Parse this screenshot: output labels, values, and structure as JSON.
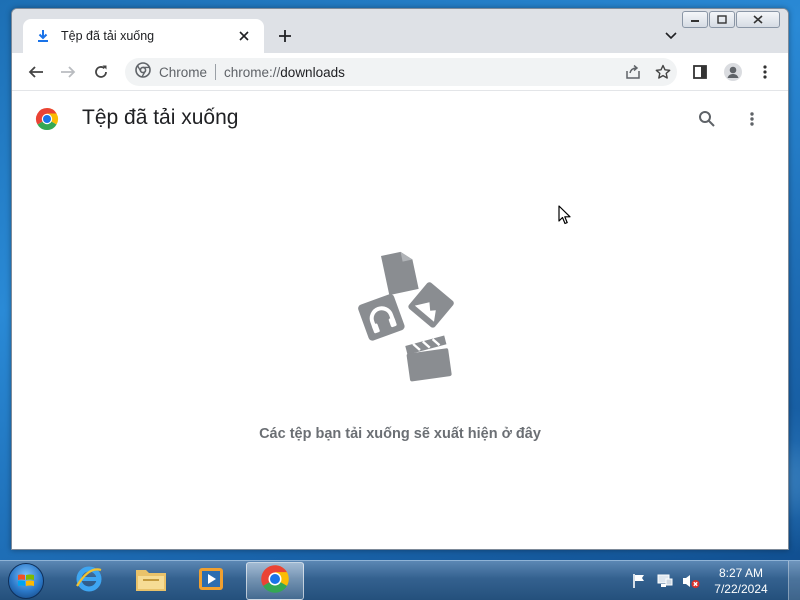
{
  "tab": {
    "title": "Tệp đã tải xuống"
  },
  "omnibox": {
    "chip_label": "Chrome",
    "url_scheme": "chrome://",
    "url_path": "downloads"
  },
  "page": {
    "title": "Tệp đã tải xuống",
    "empty_message": "Các tệp bạn tải xuống sẽ xuất hiện ở đây"
  },
  "taskbar": {
    "apps": [
      "internet-explorer",
      "file-explorer",
      "media-player",
      "chrome"
    ],
    "clock_time": "8:27 AM",
    "clock_date": "7/22/2024"
  },
  "colors": {
    "accent_blue": "#1a73e8",
    "illustration_gray": "#8a8d91"
  }
}
